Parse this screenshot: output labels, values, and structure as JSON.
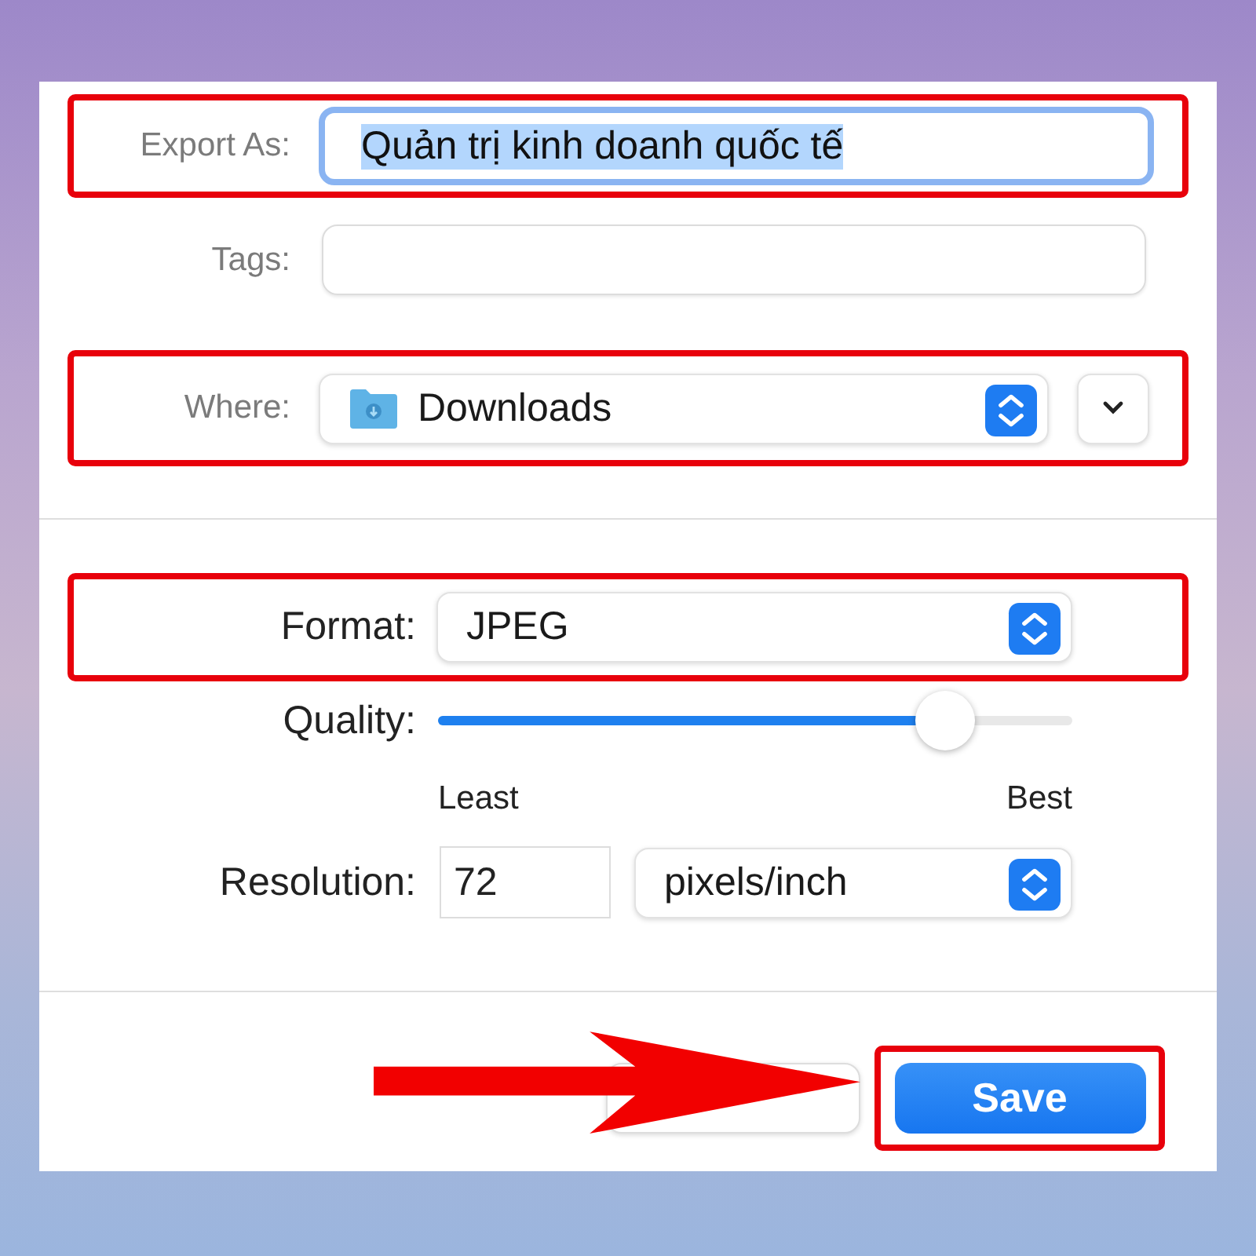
{
  "export_as": {
    "label": "Export As:",
    "value": "Quản trị kinh doanh quốc tế",
    "focused": true,
    "highlighted": true
  },
  "tags": {
    "label": "Tags:"
  },
  "where": {
    "label": "Where:",
    "value": "Downloads",
    "highlighted": true
  },
  "format": {
    "label": "Format:",
    "value": "JPEG",
    "highlighted": true
  },
  "quality": {
    "label": "Quality:",
    "level": 0.8,
    "min_label": "Least",
    "max_label": "Best"
  },
  "resolution": {
    "label": "Resolution:",
    "value": "72",
    "unit": "pixels/inch"
  },
  "buttons": [
    {
      "kind": "cancel",
      "highlighted": false
    },
    {
      "kind": "save",
      "label": "Save",
      "highlighted": true
    }
  ]
}
